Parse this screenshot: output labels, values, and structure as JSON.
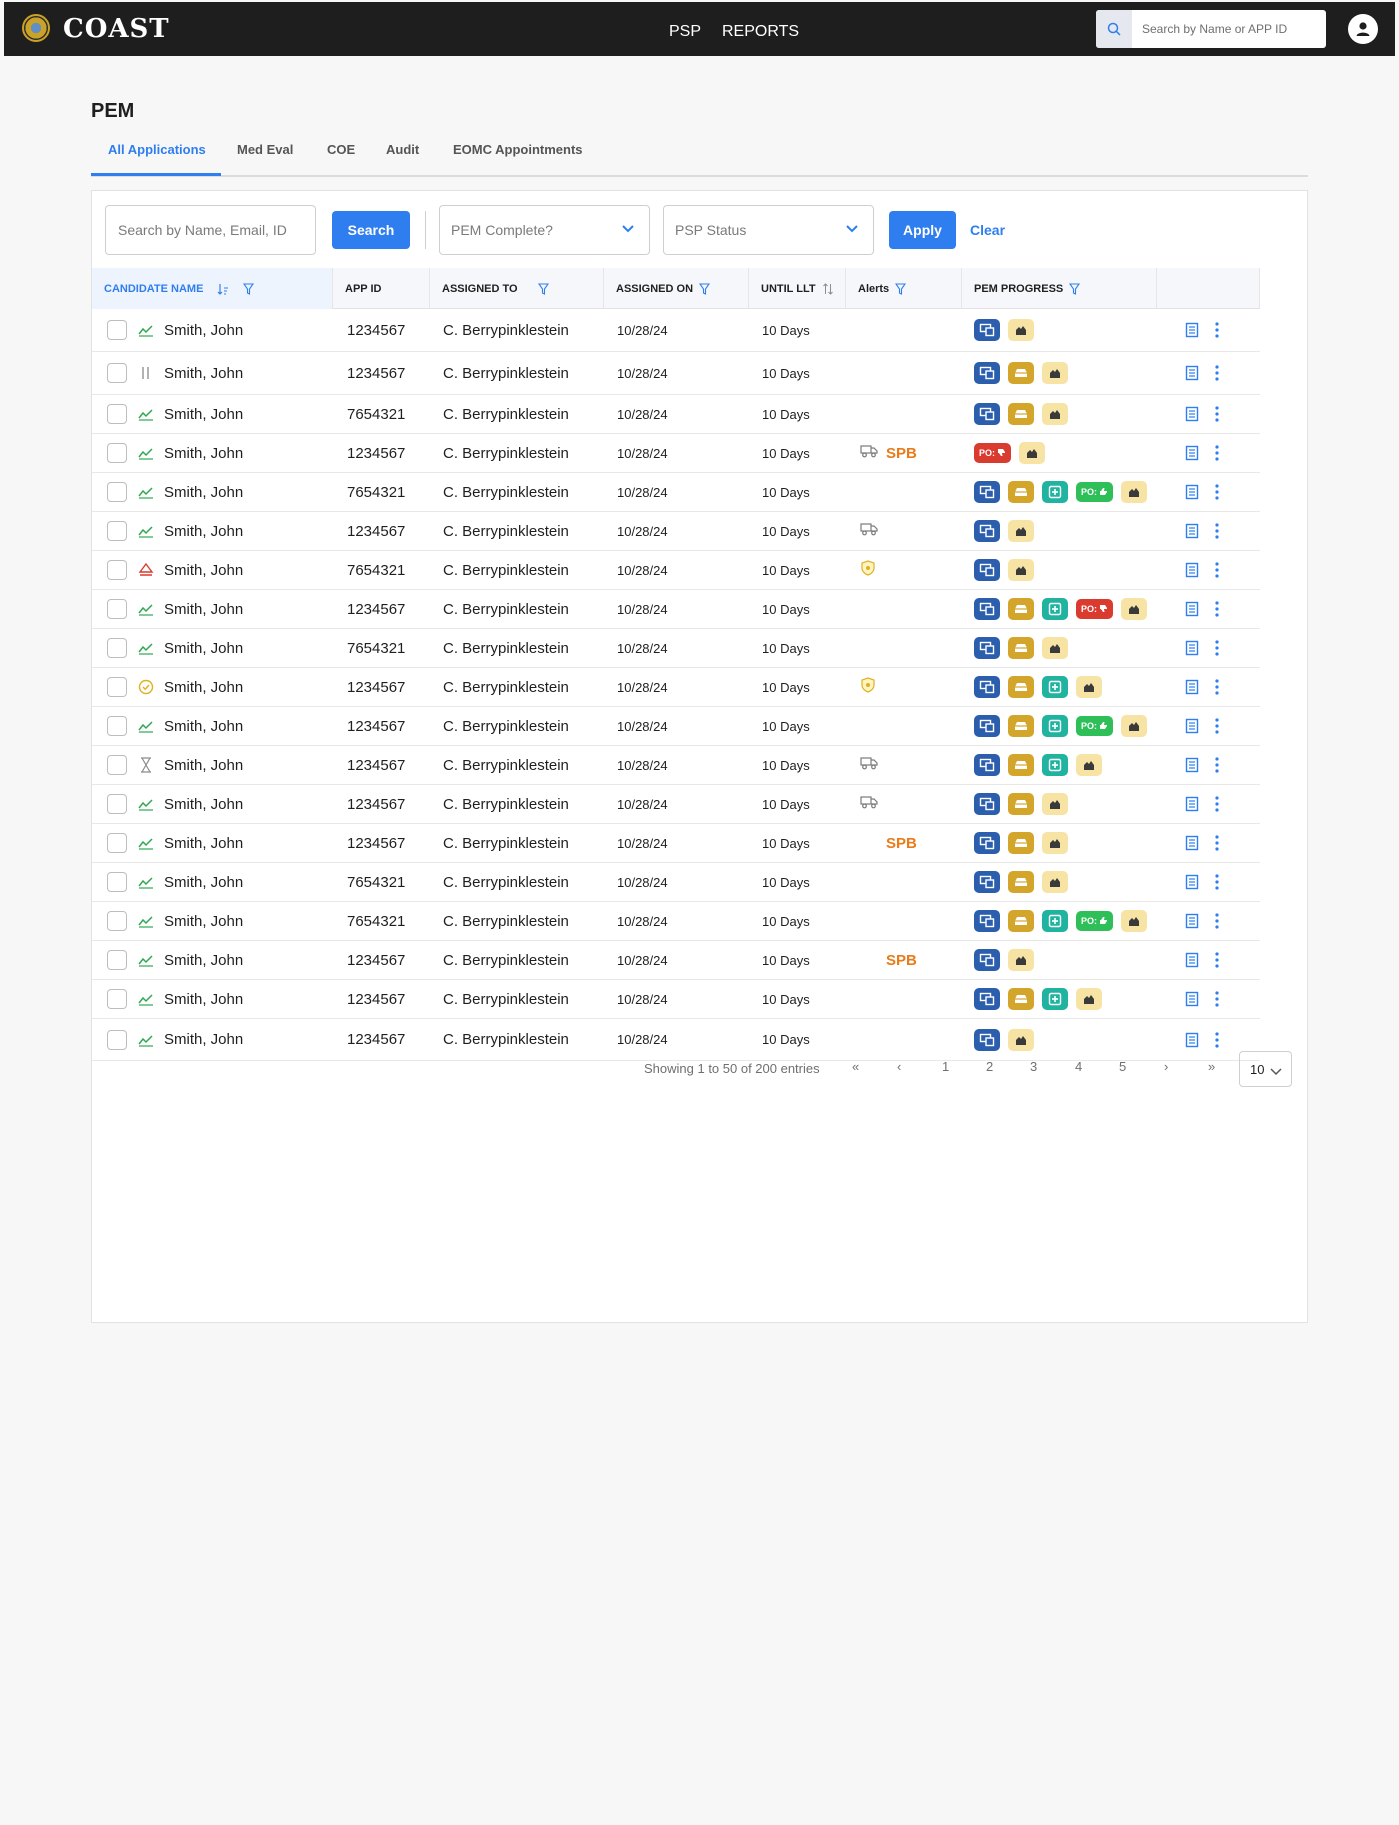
{
  "app": {
    "title": "COAST"
  },
  "nav": {
    "items": [
      "PSP",
      "REPORTS"
    ]
  },
  "global_search": {
    "placeholder": "Search by Name or APP ID"
  },
  "page": {
    "title": "PEM"
  },
  "tabs": [
    "All Applications",
    "Med Eval",
    "COE",
    "Audit",
    "EOMC Appointments"
  ],
  "filters": {
    "search_placeholder": "Search by Name, Email, ID",
    "search_button": "Search",
    "pem_complete": "PEM Complete?",
    "psp_status": "PSP Status",
    "apply": "Apply",
    "clear": "Clear"
  },
  "columns": [
    "CANDIDATE NAME",
    "APP ID",
    "ASSIGNED TO",
    "ASSIGNED ON",
    "UNTIL LLT",
    "Alerts",
    "PEM PROGRESS"
  ],
  "rows": [
    {
      "status": "trend",
      "name": "Smith, John",
      "app_id": "1234567",
      "assigned_to": "C. Berrypinklestein",
      "assigned_on": "10/28/24",
      "until_llt": "10 Days",
      "alert": "",
      "progress": [
        "blue",
        "light"
      ]
    },
    {
      "status": "pause",
      "name": "Smith, John",
      "app_id": "1234567",
      "assigned_to": "C. Berrypinklestein",
      "assigned_on": "10/28/24",
      "until_llt": "10 Days",
      "alert": "",
      "progress": [
        "blue",
        "gold",
        "light"
      ]
    },
    {
      "status": "trend",
      "name": "Smith, John",
      "app_id": "7654321",
      "assigned_to": "C. Berrypinklestein",
      "assigned_on": "10/28/24",
      "until_llt": "10 Days",
      "alert": "",
      "progress": [
        "blue",
        "gold",
        "light"
      ]
    },
    {
      "status": "trend",
      "name": "Smith, John",
      "app_id": "1234567",
      "assigned_to": "C. Berrypinklestein",
      "assigned_on": "10/28/24",
      "until_llt": "10 Days",
      "alert": "truck-spb",
      "progress": [
        "po-red",
        "light"
      ]
    },
    {
      "status": "trend",
      "name": "Smith, John",
      "app_id": "7654321",
      "assigned_to": "C. Berrypinklestein",
      "assigned_on": "10/28/24",
      "until_llt": "10 Days",
      "alert": "",
      "progress": [
        "blue",
        "gold",
        "teal",
        "po-green",
        "light"
      ]
    },
    {
      "status": "trend",
      "name": "Smith, John",
      "app_id": "1234567",
      "assigned_to": "C. Berrypinklestein",
      "assigned_on": "10/28/24",
      "until_llt": "10 Days",
      "alert": "truck",
      "progress": [
        "blue",
        "light"
      ]
    },
    {
      "status": "warning",
      "name": "Smith, John",
      "app_id": "7654321",
      "assigned_to": "C. Berrypinklestein",
      "assigned_on": "10/28/24",
      "until_llt": "10 Days",
      "alert": "shield",
      "progress": [
        "blue",
        "light"
      ]
    },
    {
      "status": "trend",
      "name": "Smith, John",
      "app_id": "1234567",
      "assigned_to": "C. Berrypinklestein",
      "assigned_on": "10/28/24",
      "until_llt": "10 Days",
      "alert": "",
      "progress": [
        "blue",
        "gold",
        "teal",
        "po-red",
        "light"
      ]
    },
    {
      "status": "trend",
      "name": "Smith, John",
      "app_id": "7654321",
      "assigned_to": "C. Berrypinklestein",
      "assigned_on": "10/28/24",
      "until_llt": "10 Days",
      "alert": "",
      "progress": [
        "blue",
        "gold",
        "light"
      ]
    },
    {
      "status": "check",
      "name": "Smith, John",
      "app_id": "1234567",
      "assigned_to": "C. Berrypinklestein",
      "assigned_on": "10/28/24",
      "until_llt": "10 Days",
      "alert": "shield",
      "progress": [
        "blue",
        "gold",
        "teal",
        "light"
      ]
    },
    {
      "status": "trend",
      "name": "Smith, John",
      "app_id": "1234567",
      "assigned_to": "C. Berrypinklestein",
      "assigned_on": "10/28/24",
      "until_llt": "10 Days",
      "alert": "",
      "progress": [
        "blue",
        "gold",
        "teal",
        "po-green",
        "light"
      ]
    },
    {
      "status": "hourglass",
      "name": "Smith, John",
      "app_id": "1234567",
      "assigned_to": "C. Berrypinklestein",
      "assigned_on": "10/28/24",
      "until_llt": "10 Days",
      "alert": "truck",
      "progress": [
        "blue",
        "gold",
        "teal",
        "light"
      ]
    },
    {
      "status": "trend",
      "name": "Smith, John",
      "app_id": "1234567",
      "assigned_to": "C. Berrypinklestein",
      "assigned_on": "10/28/24",
      "until_llt": "10 Days",
      "alert": "truck",
      "progress": [
        "blue",
        "gold",
        "light"
      ]
    },
    {
      "status": "trend",
      "name": "Smith, John",
      "app_id": "1234567",
      "assigned_to": "C. Berrypinklestein",
      "assigned_on": "10/28/24",
      "until_llt": "10 Days",
      "alert": "spb",
      "progress": [
        "blue",
        "gold",
        "light"
      ]
    },
    {
      "status": "trend",
      "name": "Smith, John",
      "app_id": "7654321",
      "assigned_to": "C. Berrypinklestein",
      "assigned_on": "10/28/24",
      "until_llt": "10 Days",
      "alert": "",
      "progress": [
        "blue",
        "gold",
        "light"
      ]
    },
    {
      "status": "trend",
      "name": "Smith, John",
      "app_id": "7654321",
      "assigned_to": "C. Berrypinklestein",
      "assigned_on": "10/28/24",
      "until_llt": "10 Days",
      "alert": "",
      "progress": [
        "blue",
        "gold",
        "teal",
        "po-green",
        "light"
      ]
    },
    {
      "status": "trend",
      "name": "Smith, John",
      "app_id": "1234567",
      "assigned_to": "C. Berrypinklestein",
      "assigned_on": "10/28/24",
      "until_llt": "10 Days",
      "alert": "spb",
      "progress": [
        "blue",
        "light"
      ]
    },
    {
      "status": "trend",
      "name": "Smith, John",
      "app_id": "1234567",
      "assigned_to": "C. Berrypinklestein",
      "assigned_on": "10/28/24",
      "until_llt": "10 Days",
      "alert": "",
      "progress": [
        "blue",
        "gold",
        "teal",
        "light"
      ]
    },
    {
      "status": "trend",
      "name": "Smith, John",
      "app_id": "1234567",
      "assigned_to": "C. Berrypinklestein",
      "assigned_on": "10/28/24",
      "until_llt": "10 Days",
      "alert": "",
      "progress": [
        "blue",
        "light"
      ]
    }
  ],
  "labels": {
    "spb": "SPB",
    "po": "PO:"
  },
  "pagination": {
    "summary": "Showing 1 to 50 of 200 entries",
    "pages": [
      "1",
      "2",
      "3",
      "4",
      "5"
    ],
    "page_size": "10"
  },
  "colors": {
    "accent": "#2f7ef0",
    "topbar": "#1e1e1e",
    "spb": "#e97c1a",
    "trend": "#2fa84f",
    "warning": "#d93b2f"
  }
}
